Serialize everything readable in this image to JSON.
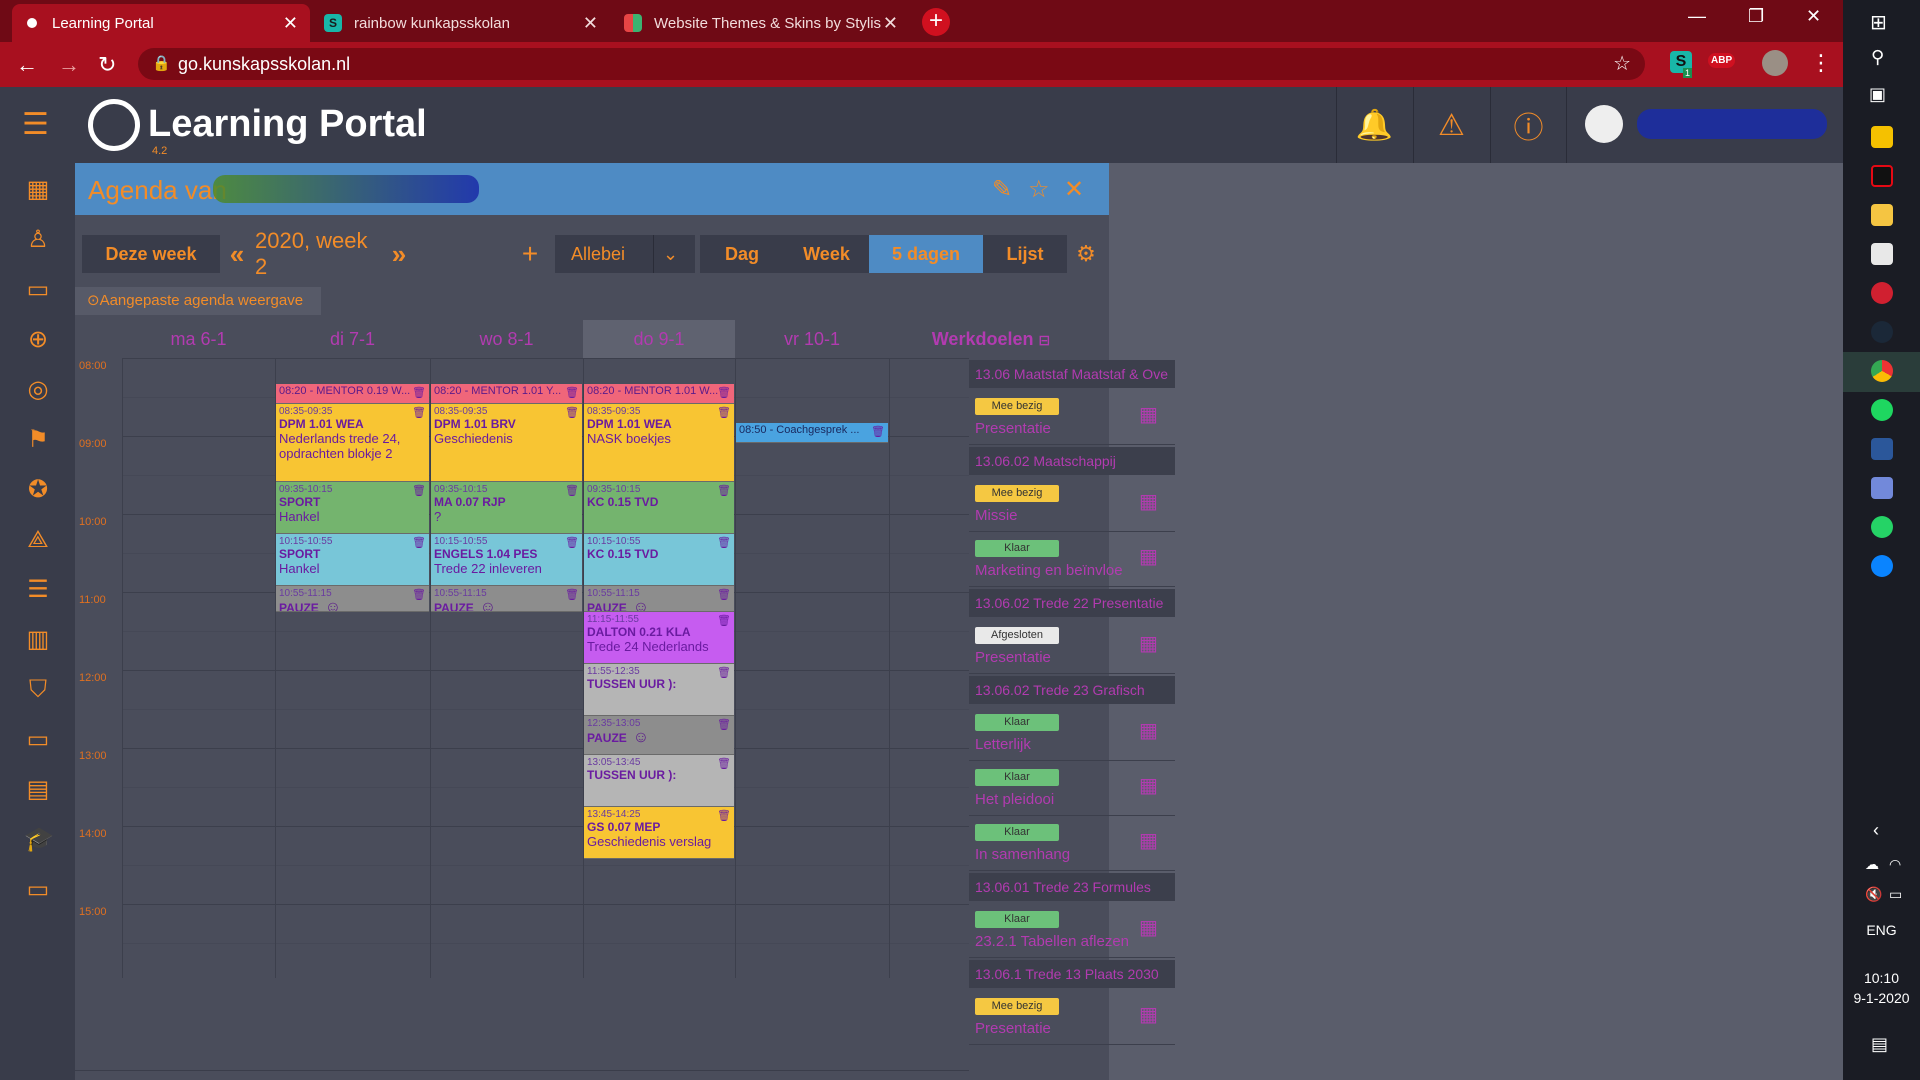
{
  "browser": {
    "tabs": [
      {
        "title": "Learning Portal",
        "active": true
      },
      {
        "title": "rainbow kunkapsskolan",
        "active": false
      },
      {
        "title": "Website Themes & Skins by Stylis",
        "active": false
      }
    ],
    "url": "go.kunskapsskolan.nl",
    "ext_badge": "1",
    "abp": "ABP"
  },
  "app": {
    "title": "Learning Portal",
    "version": "4.2"
  },
  "panel": {
    "title": "Agenda van",
    "this_week": "Deze week",
    "week_label": "2020, week 2",
    "filter": "Allebei",
    "views": [
      "Dag",
      "Week",
      "5 dagen",
      "Lijst"
    ],
    "custom_view": "⊙Aangepaste agenda weergave",
    "days": [
      "ma 6-1",
      "di 7-1",
      "wo 8-1",
      "do 9-1",
      "vr 10-1"
    ],
    "goals_title": "Werkdoelen"
  },
  "hours": [
    "08:00",
    "09:00",
    "10:00",
    "11:00",
    "12:00",
    "13:00",
    "14:00",
    "15:00"
  ],
  "events": [
    {
      "col": 1,
      "start": "08:20",
      "end": "08:35",
      "label": "08:20 - MENTOR 0.19 W...",
      "type": "mentor"
    },
    {
      "col": 2,
      "start": "08:20",
      "end": "08:35",
      "label": "08:20 - MENTOR 1.01 Y...",
      "type": "mentor"
    },
    {
      "col": 3,
      "start": "08:20",
      "end": "08:35",
      "label": "08:20 - MENTOR 1.01 W...",
      "type": "mentor"
    },
    {
      "col": 1,
      "start": "08:35",
      "end": "09:35",
      "time": "08:35-09:35",
      "name": "DPM 1.01 WEA",
      "desc": "Nederlands trede 24, opdrachten blokje 2",
      "type": "yellow"
    },
    {
      "col": 2,
      "start": "08:35",
      "end": "09:35",
      "time": "08:35-09:35",
      "name": "DPM 1.01 BRV",
      "desc": "Geschiedenis",
      "type": "yellow"
    },
    {
      "col": 3,
      "start": "08:35",
      "end": "09:35",
      "time": "08:35-09:35",
      "name": "DPM 1.01 WEA",
      "desc": "NASK boekjes",
      "type": "yellow"
    },
    {
      "col": 4,
      "start": "08:50",
      "end": "09:05",
      "label": "08:50 - Coachgesprek ...",
      "type": "blue"
    },
    {
      "col": 1,
      "start": "09:35",
      "end": "10:15",
      "time": "09:35-10:15",
      "name": "SPORT",
      "desc": "Hankel",
      "type": "green"
    },
    {
      "col": 2,
      "start": "09:35",
      "end": "10:15",
      "time": "09:35-10:15",
      "name": "MA 0.07 RJP",
      "desc": "?",
      "type": "green"
    },
    {
      "col": 3,
      "start": "09:35",
      "end": "10:15",
      "time": "09:35-10:15",
      "name": "KC 0.15 TVD",
      "desc": "",
      "type": "green"
    },
    {
      "col": 1,
      "start": "10:15",
      "end": "10:55",
      "time": "10:15-10:55",
      "name": "SPORT",
      "desc": "Hankel",
      "type": "cyan"
    },
    {
      "col": 2,
      "start": "10:15",
      "end": "10:55",
      "time": "10:15-10:55",
      "name": "ENGELS 1.04 PES",
      "desc": "Trede 22 inleveren",
      "type": "cyan"
    },
    {
      "col": 3,
      "start": "10:15",
      "end": "10:55",
      "time": "10:15-10:55",
      "name": "KC 0.15 TVD",
      "desc": "",
      "type": "cyan"
    },
    {
      "col": 1,
      "start": "10:55",
      "end": "11:15",
      "time": "10:55-11:15",
      "name": "PAUZE",
      "desc": "",
      "type": "grey"
    },
    {
      "col": 2,
      "start": "10:55",
      "end": "11:15",
      "time": "10:55-11:15",
      "name": "PAUZE",
      "desc": "",
      "type": "grey"
    },
    {
      "col": 3,
      "start": "10:55",
      "end": "11:15",
      "time": "10:55-11:15",
      "name": "PAUZE",
      "desc": "",
      "type": "grey"
    },
    {
      "col": 3,
      "start": "11:15",
      "end": "11:55",
      "time": "11:15-11:55",
      "name": "DALTON 0.21 KLA",
      "desc": "Trede 24 Nederlands",
      "type": "purple"
    },
    {
      "col": 3,
      "start": "11:55",
      "end": "12:35",
      "time": "11:55-12:35",
      "name": "TUSSEN UUR ):",
      "desc": "",
      "type": "lightgrey"
    },
    {
      "col": 3,
      "start": "12:35",
      "end": "13:05",
      "time": "12:35-13:05",
      "name": "PAUZE",
      "desc": "",
      "type": "grey"
    },
    {
      "col": 3,
      "start": "13:05",
      "end": "13:45",
      "time": "13:05-13:45",
      "name": "TUSSEN UUR ):",
      "desc": "",
      "type": "lightgrey"
    },
    {
      "col": 3,
      "start": "13:45",
      "end": "14:25",
      "time": "13:45-14:25",
      "name": "GS 0.07 MEP",
      "desc": "Geschiedenis verslag",
      "type": "yellow"
    }
  ],
  "goals": [
    {
      "kind": "head",
      "text": "13.06 Maatstaf Maatstaf & Ove"
    },
    {
      "kind": "item",
      "status": "Mee bezig",
      "name": "Presentatie"
    },
    {
      "kind": "head",
      "text": "13.06.02 Maatschappij"
    },
    {
      "kind": "item",
      "status": "Mee bezig",
      "name": "Missie"
    },
    {
      "kind": "item",
      "status": "Klaar",
      "name": "Marketing en beïnvloe"
    },
    {
      "kind": "head",
      "text": "13.06.02 Trede 22 Presentatie"
    },
    {
      "kind": "item",
      "status": "Afgesloten",
      "name": "Presentatie"
    },
    {
      "kind": "head",
      "text": "13.06.02 Trede 23 Grafisch"
    },
    {
      "kind": "item",
      "status": "Klaar",
      "name": "Letterlijk"
    },
    {
      "kind": "item",
      "status": "Klaar",
      "name": "Het pleidooi"
    },
    {
      "kind": "item",
      "status": "Klaar",
      "name": "In samenhang"
    },
    {
      "kind": "head",
      "text": "13.06.01 Trede 23 Formules"
    },
    {
      "kind": "item",
      "status": "Klaar",
      "name": "23.2.1 Tabellen aflezen"
    },
    {
      "kind": "head",
      "text": "13.06.1 Trede 13 Plaats 2030"
    },
    {
      "kind": "item",
      "status": "Mee bezig",
      "name": "Presentatie"
    }
  ],
  "status_colors": {
    "Mee bezig": "#f5c842",
    "Klaar": "#6cc17a",
    "Afgesloten": "#e9e9e9"
  },
  "event_colors": {
    "mentor": "#f0667a",
    "yellow": "#f8c533",
    "blue": "#4aa3e0",
    "green": "#74b46e",
    "cyan": "#78c6d8",
    "grey": "#8d8d8d",
    "purple": "#c65cf0",
    "lightgrey": "#b5b5b5"
  },
  "system": {
    "lang": "ENG",
    "time": "10:10",
    "date": "9-1-2020"
  }
}
